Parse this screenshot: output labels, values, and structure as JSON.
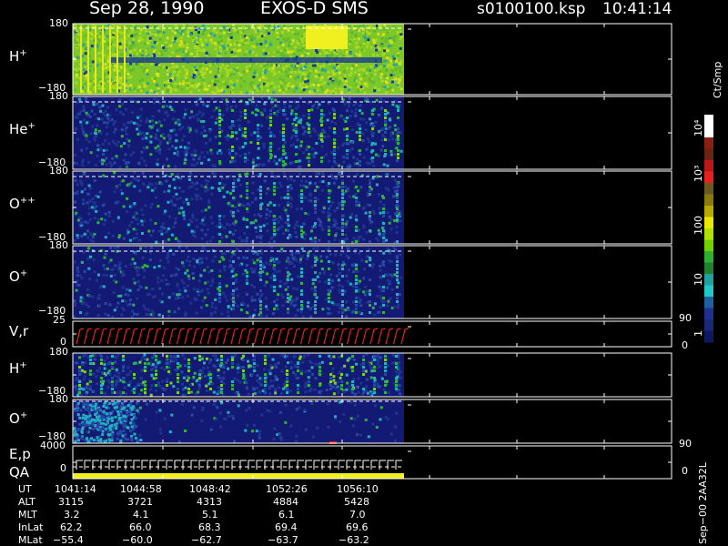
{
  "header": {
    "date": "Sep 28, 1990",
    "instrument": "EXOS-D SMS",
    "filename": "s0100100.ksp",
    "time": "10:41:14"
  },
  "panels": [
    {
      "label": "H",
      "sup": "+",
      "ytop": "180",
      "ybot": "−180"
    },
    {
      "label": "He",
      "sup": "+",
      "ytop": "180",
      "ybot": "−180"
    },
    {
      "label": "O",
      "sup": "++",
      "ytop": "180",
      "ybot": "−180"
    },
    {
      "label": "O",
      "sup": "+",
      "ytop": "180",
      "ybot": "−180"
    },
    {
      "label": "V,r",
      "sup": "",
      "ytop": "25",
      "ymid": "0",
      "right_top": "90",
      "right_bot": "0"
    },
    {
      "label": "H",
      "sup": "+",
      "ytop": "180",
      "ybot": "−180"
    },
    {
      "label": "O",
      "sup": "+",
      "ytop": "180",
      "ybot": "−180"
    },
    {
      "label": "E,p",
      "label2": "QA",
      "ytop": "4000",
      "ymid": "0",
      "right_top": "90",
      "right_bot": "0"
    }
  ],
  "colorbar": {
    "unit": "Ct/Smp",
    "labels": [
      "10⁴",
      "10³",
      "100",
      "10",
      "1"
    ],
    "colors": [
      "#ffffff",
      "#ffffff",
      "#8a1f14",
      "#6a2414",
      "#b81818",
      "#e82020",
      "#6a5a20",
      "#8a7a10",
      "#b8a800",
      "#e8e800",
      "#b0e000",
      "#70d000",
      "#30b030",
      "#208030",
      "#20a0a0",
      "#20c8c8",
      "#2060a0",
      "#203090",
      "#1a2878",
      "#101860"
    ]
  },
  "footer": {
    "rows": [
      {
        "name": "UT",
        "values": [
          "1041:14",
          "1044:58",
          "1048:42",
          "1052:26",
          "1056:10"
        ]
      },
      {
        "name": "ALT",
        "values": [
          "3115",
          "3721",
          "4313",
          "4884",
          "5428"
        ]
      },
      {
        "name": "MLT",
        "values": [
          "3.2",
          "4.1",
          "5.1",
          "6.1",
          "7.0"
        ]
      },
      {
        "name": "InLat",
        "values": [
          "62.2",
          "66.0",
          "68.3",
          "69.4",
          "69.6"
        ]
      },
      {
        "name": "MLat",
        "values": [
          "−55.4",
          "−60.0",
          "−62.7",
          "−63.7",
          "−63.2"
        ]
      }
    ],
    "side_label": "Sep−00  2AA32L"
  },
  "chart_data": {
    "type": "heatmap",
    "title": "Sep 28, 1990   EXOS-D SMS",
    "xlabel": "UT",
    "x_ticks": [
      "1041:14",
      "1044:58",
      "1048:42",
      "1052:26",
      "1056:10"
    ],
    "z_unit": "Ct/Smp",
    "z_scale": "log",
    "z_range": [
      1,
      10000
    ],
    "grid": false,
    "legend": "colorbar right",
    "series": [
      {
        "name": "H+",
        "ylim": [
          -180,
          180
        ]
      },
      {
        "name": "He+",
        "ylim": [
          -180,
          180
        ]
      },
      {
        "name": "O++",
        "ylim": [
          -180,
          180
        ]
      },
      {
        "name": "O+",
        "ylim": [
          -180,
          180
        ]
      },
      {
        "name": "V,r",
        "ylim": [
          0,
          25
        ],
        "right_axis": [
          0,
          90
        ]
      },
      {
        "name": "H+",
        "ylim": [
          -180,
          180
        ]
      },
      {
        "name": "O+",
        "ylim": [
          -180,
          180
        ]
      },
      {
        "name": "E,p / QA",
        "ylim": [
          0,
          4000
        ],
        "right_axis": [
          0,
          90
        ]
      }
    ]
  }
}
